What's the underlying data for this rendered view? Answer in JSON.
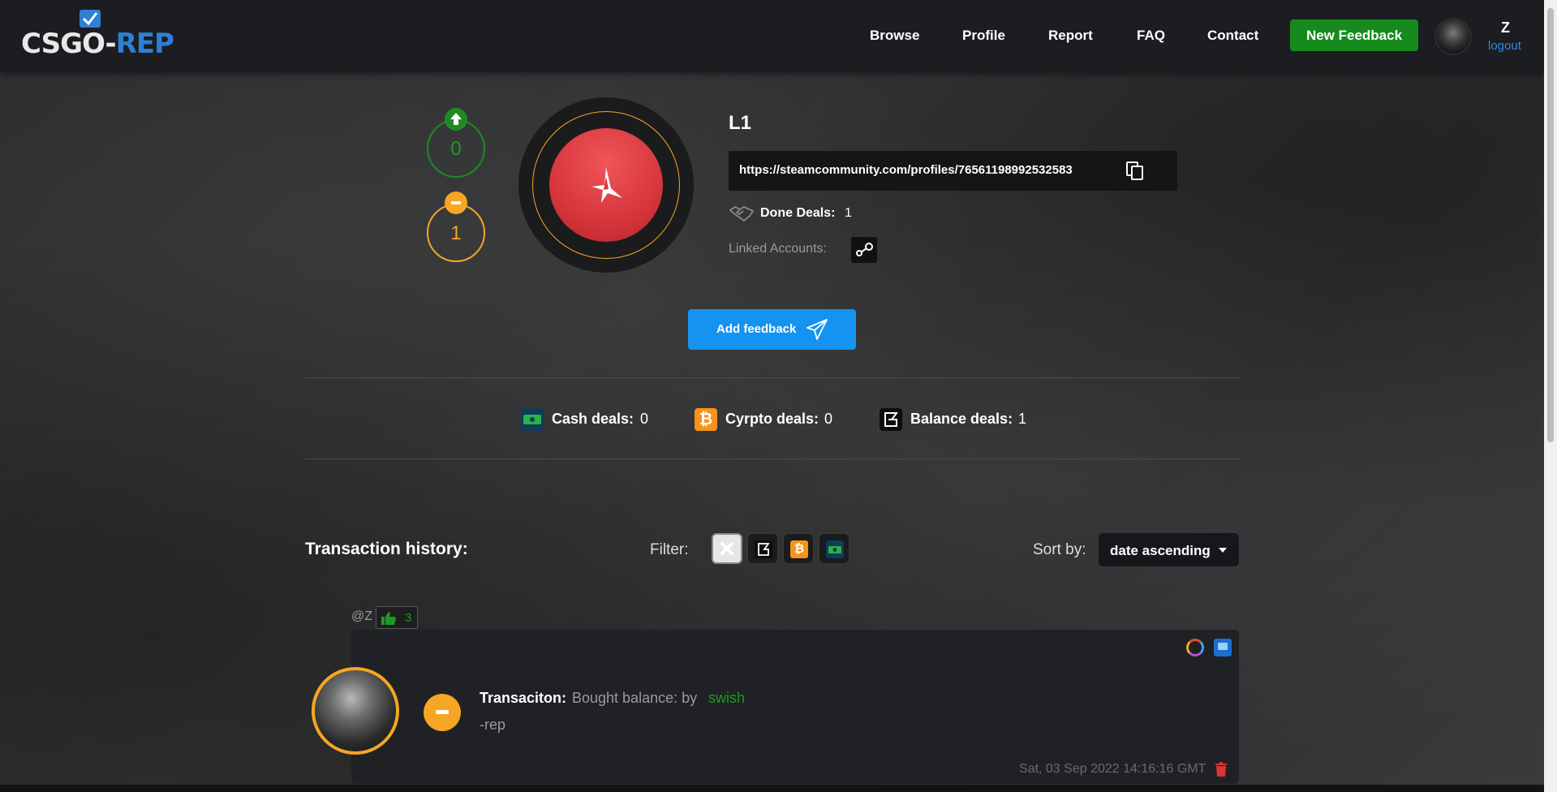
{
  "header": {
    "logo_main": "CSGO-",
    "logo_accent": "REP",
    "nav": [
      "Browse",
      "Profile",
      "Report",
      "FAQ",
      "Contact"
    ],
    "new_feedback_label": "New Feedback",
    "user_name": "Z",
    "logout_label": "logout"
  },
  "profile": {
    "positive_count": "0",
    "negative_count": "1",
    "name": "L1",
    "steam_url": "https://steamcommunity.com/profiles/76561198992532583",
    "done_deals_label": "Done Deals:",
    "done_deals_value": "1",
    "linked_accounts_label": "Linked Accounts:",
    "add_feedback_label": "Add feedback"
  },
  "stats": {
    "cash_label": "Cash deals:",
    "cash_value": "0",
    "crypto_label": "Cyrpto deals:",
    "crypto_value": "0",
    "balance_label": "Balance deals:",
    "balance_value": "1"
  },
  "history": {
    "title": "Transaction history:",
    "filter_label": "Filter:",
    "sort_label": "Sort by:",
    "sort_value": "date ascending"
  },
  "feedback": {
    "author": "@Z",
    "likes": "3",
    "transaction_label": "Transaciton:",
    "transaction_desc": "Bought balance: by",
    "transaction_by": "swish",
    "comment": "-rep",
    "date": "Sat, 03 Sep 2022 14:16:16 GMT"
  },
  "colors": {
    "accent_green": "#178a1e",
    "accent_orange": "#f5a623",
    "accent_blue": "#1593f0",
    "header_bg": "#1b1d20"
  }
}
